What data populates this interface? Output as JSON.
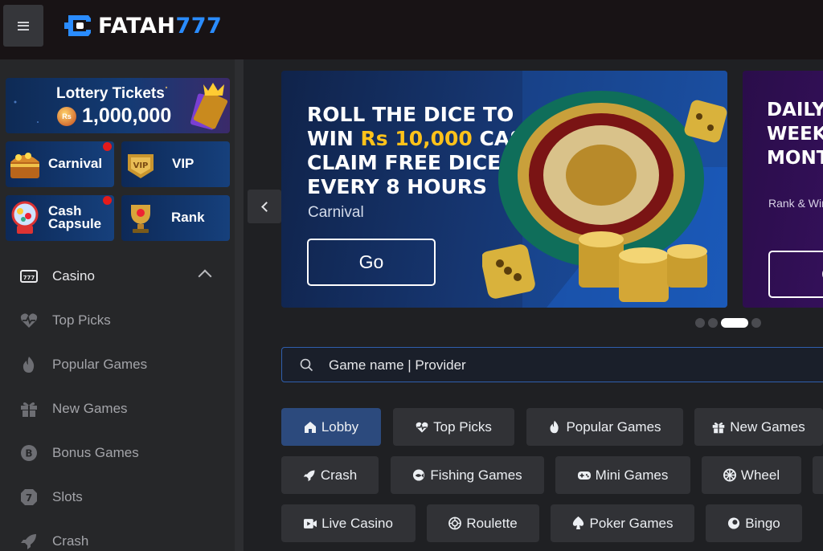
{
  "header": {
    "menu_icon": "hamburger-icon",
    "logo": {
      "text_white": "FATAH",
      "text_blue": "777",
      "mark_color": "#2a8cff"
    }
  },
  "sidebar": {
    "lottery": {
      "title": "Lottery Tickets",
      "coin_label": "Rs",
      "amount": "1,000,000"
    },
    "tiles": [
      {
        "label": "Carnival",
        "icon": "treasure-chest-icon",
        "notification": true
      },
      {
        "label": "VIP",
        "icon": "vip-badge-icon",
        "notification": false
      },
      {
        "label": "Cash\nCapsule",
        "line1": "Cash",
        "line2": "Capsule",
        "icon": "gumball-machine-icon",
        "notification": true
      },
      {
        "label": "Rank",
        "icon": "trophy-icon",
        "notification": false
      }
    ],
    "section": {
      "label": "Casino",
      "icon": "slot-machine-icon",
      "expanded": true
    },
    "items": [
      {
        "label": "Top Picks",
        "icon": "heart-pulse-icon"
      },
      {
        "label": "Popular Games",
        "icon": "fire-icon"
      },
      {
        "label": "New Games",
        "icon": "gift-icon"
      },
      {
        "label": "Bonus Games",
        "icon": "bonus-coin-icon"
      },
      {
        "label": "Slots",
        "icon": "slot-seven-icon"
      },
      {
        "label": "Crash",
        "icon": "rocket-icon"
      }
    ]
  },
  "banner": {
    "line1": "ROLL THE DICE TO",
    "line2_pre": "WIN ",
    "line2_highlight": "Rs 10,000",
    "line2_post": " CASH",
    "line3": "CLAIM FREE DICE",
    "line4": "EVERY 8 HOURS",
    "subtitle": "Carnival",
    "button": "Go",
    "highlight_color": "#ffc21a"
  },
  "banner2": {
    "line1": "DAILY",
    "line2": "WEEK",
    "line3": "MONT",
    "subtitle": "Rank & Win",
    "button": "G"
  },
  "carousel": {
    "slide_count": 4,
    "active_index": 2
  },
  "search": {
    "placeholder": "Game name | Provider",
    "accent": "#2f5fae"
  },
  "categories": [
    {
      "label": "Lobby",
      "icon": "home-icon",
      "active": true
    },
    {
      "label": "Top Picks",
      "icon": "heart-pulse-icon"
    },
    {
      "label": "Popular Games",
      "icon": "fire-icon"
    },
    {
      "label": "New Games",
      "icon": "gift-icon"
    },
    {
      "label": "Crash",
      "icon": "rocket-icon"
    },
    {
      "label": "Fishing Games",
      "icon": "fishing-icon"
    },
    {
      "label": "Mini Games",
      "icon": "gamepad-icon"
    },
    {
      "label": "Wheel",
      "icon": "wheel-icon"
    },
    {
      "label": "Live Casino",
      "icon": "video-play-icon"
    },
    {
      "label": "Roulette",
      "icon": "roulette-icon"
    },
    {
      "label": "Poker Games",
      "icon": "spade-icon"
    },
    {
      "label": "Bingo",
      "icon": "bingo-ball-icon"
    }
  ]
}
